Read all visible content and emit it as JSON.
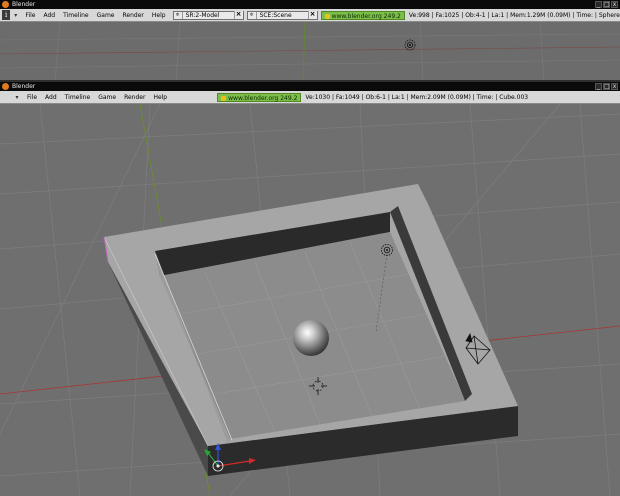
{
  "top_window": {
    "title": "Blender",
    "menu": [
      "File",
      "Add",
      "Timeline",
      "Game",
      "Render",
      "Help"
    ],
    "screen_field": "SR:2-Model",
    "scene_field": "SCE:Scene",
    "url": "www.blender.org 249.2",
    "stats": "Ve:998 | Fa:1025 | Ob:4-1 | La:1  | Mem:1.29M (0.09M)  | Time: | Sphere"
  },
  "bottom_window": {
    "title": "Blender",
    "menu": [
      "File",
      "Add",
      "Timeline",
      "Game",
      "Render",
      "Help"
    ],
    "url": "www.blender.org 249.2",
    "stats": "Ve:1030 | Fa:1049 | Ob:6-1 | La:1 | Mem:2.09M (0.09M) | Time: | Cube.003"
  },
  "window_buttons": [
    "_",
    "□",
    "x"
  ],
  "icons": {
    "info": "info-icon",
    "menu_toggle": "chevron-down-icon",
    "lamp": "lamp-icon",
    "camera": "camera-icon",
    "cursor": "3d-cursor-icon"
  },
  "colors": {
    "title_bar": "#0a0a0a",
    "menu_bar": "#d8d8d8",
    "url_pill": "#7dbd4a",
    "viewport": "#6f6f6f",
    "grid": "#7d7d7d",
    "x_axis": "#a53636",
    "y_axis": "#6b8f2a",
    "mesh_face": "#a4a4a4",
    "mesh_dark": "#272727"
  }
}
